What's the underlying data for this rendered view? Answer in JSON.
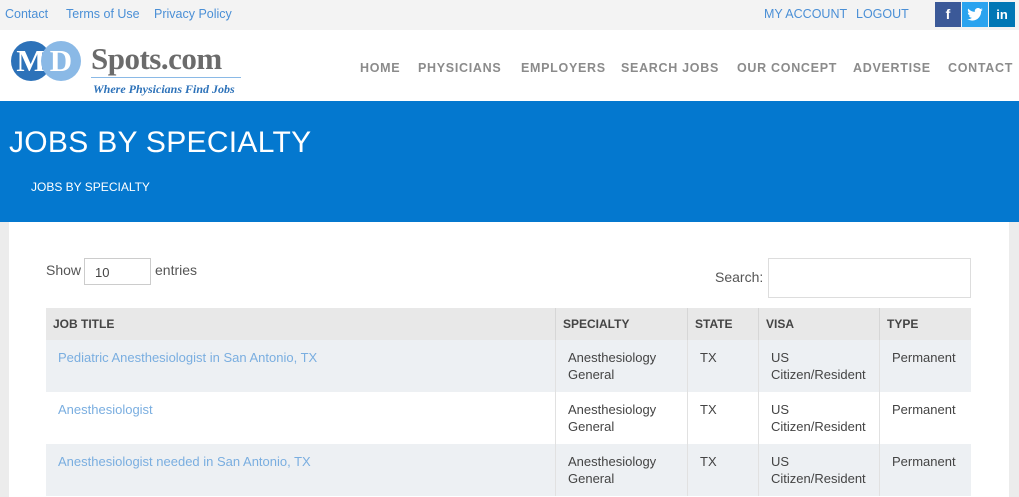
{
  "topbar": {
    "links": [
      "Contact",
      "Terms of Use",
      "Privacy Policy"
    ],
    "account": "MY ACCOUNT",
    "logout": "LOGOUT",
    "social": [
      {
        "icon": "facebook-icon",
        "glyph": "f",
        "color": "#3b5998"
      },
      {
        "icon": "twitter-icon",
        "glyph": "t",
        "color": "#2aa3ef"
      },
      {
        "icon": "linkedin-icon",
        "glyph": "in",
        "color": "#0077b5"
      }
    ]
  },
  "logo": {
    "m": "M",
    "d": "D",
    "spots": "Spots.com",
    "tagline": "Where Physicians Find Jobs"
  },
  "nav": [
    "HOME",
    "PHYSICIANS",
    "EMPLOYERS",
    "SEARCH JOBS",
    "OUR CONCEPT",
    "ADVERTISE",
    "CONTACT"
  ],
  "banner": {
    "title": "JOBS BY SPECIALTY",
    "breadcrumb": "JOBS BY SPECIALTY",
    "color": "#0478cf"
  },
  "table_controls": {
    "show_label": "Show",
    "show_value": "10",
    "entries_label": "entries",
    "search_label": "Search:",
    "search_value": ""
  },
  "table": {
    "headers": [
      "JOB TITLE",
      "SPECIALTY",
      "STATE",
      "VISA",
      "TYPE"
    ],
    "rows": [
      {
        "title": "Pediatric Anesthesiologist in San Antonio, TX",
        "specialty": [
          "Anesthesiology",
          "General"
        ],
        "state": "TX",
        "visa": [
          "US",
          "Citizen/Resident"
        ],
        "type": "Permanent"
      },
      {
        "title": "Anesthesiologist",
        "specialty": [
          "Anesthesiology",
          "General"
        ],
        "state": "TX",
        "visa": [
          "US",
          "Citizen/Resident"
        ],
        "type": "Permanent"
      },
      {
        "title": "Anesthesiologist needed in San Antonio, TX",
        "specialty": [
          "Anesthesiology",
          "General"
        ],
        "state": "TX",
        "visa": [
          "US",
          "Citizen/Resident"
        ],
        "type": "Permanent"
      }
    ]
  }
}
